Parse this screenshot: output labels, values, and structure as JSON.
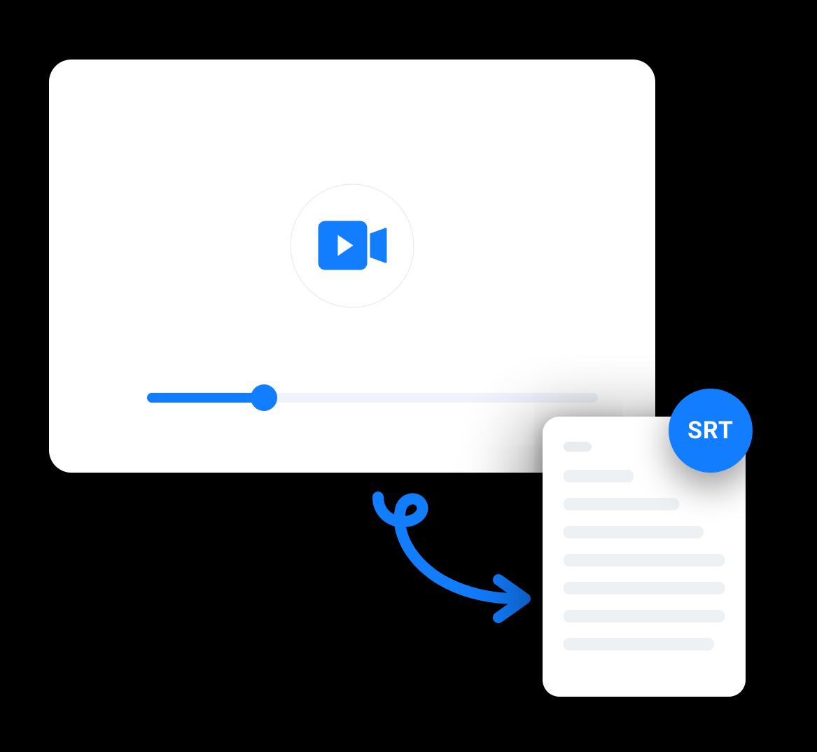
{
  "badge": {
    "label": "SRT"
  },
  "player": {
    "progress_percent": 26
  },
  "colors": {
    "accent": "#127dff",
    "track_bg": "#eef3fb",
    "doc_line": "#eef1f4"
  }
}
